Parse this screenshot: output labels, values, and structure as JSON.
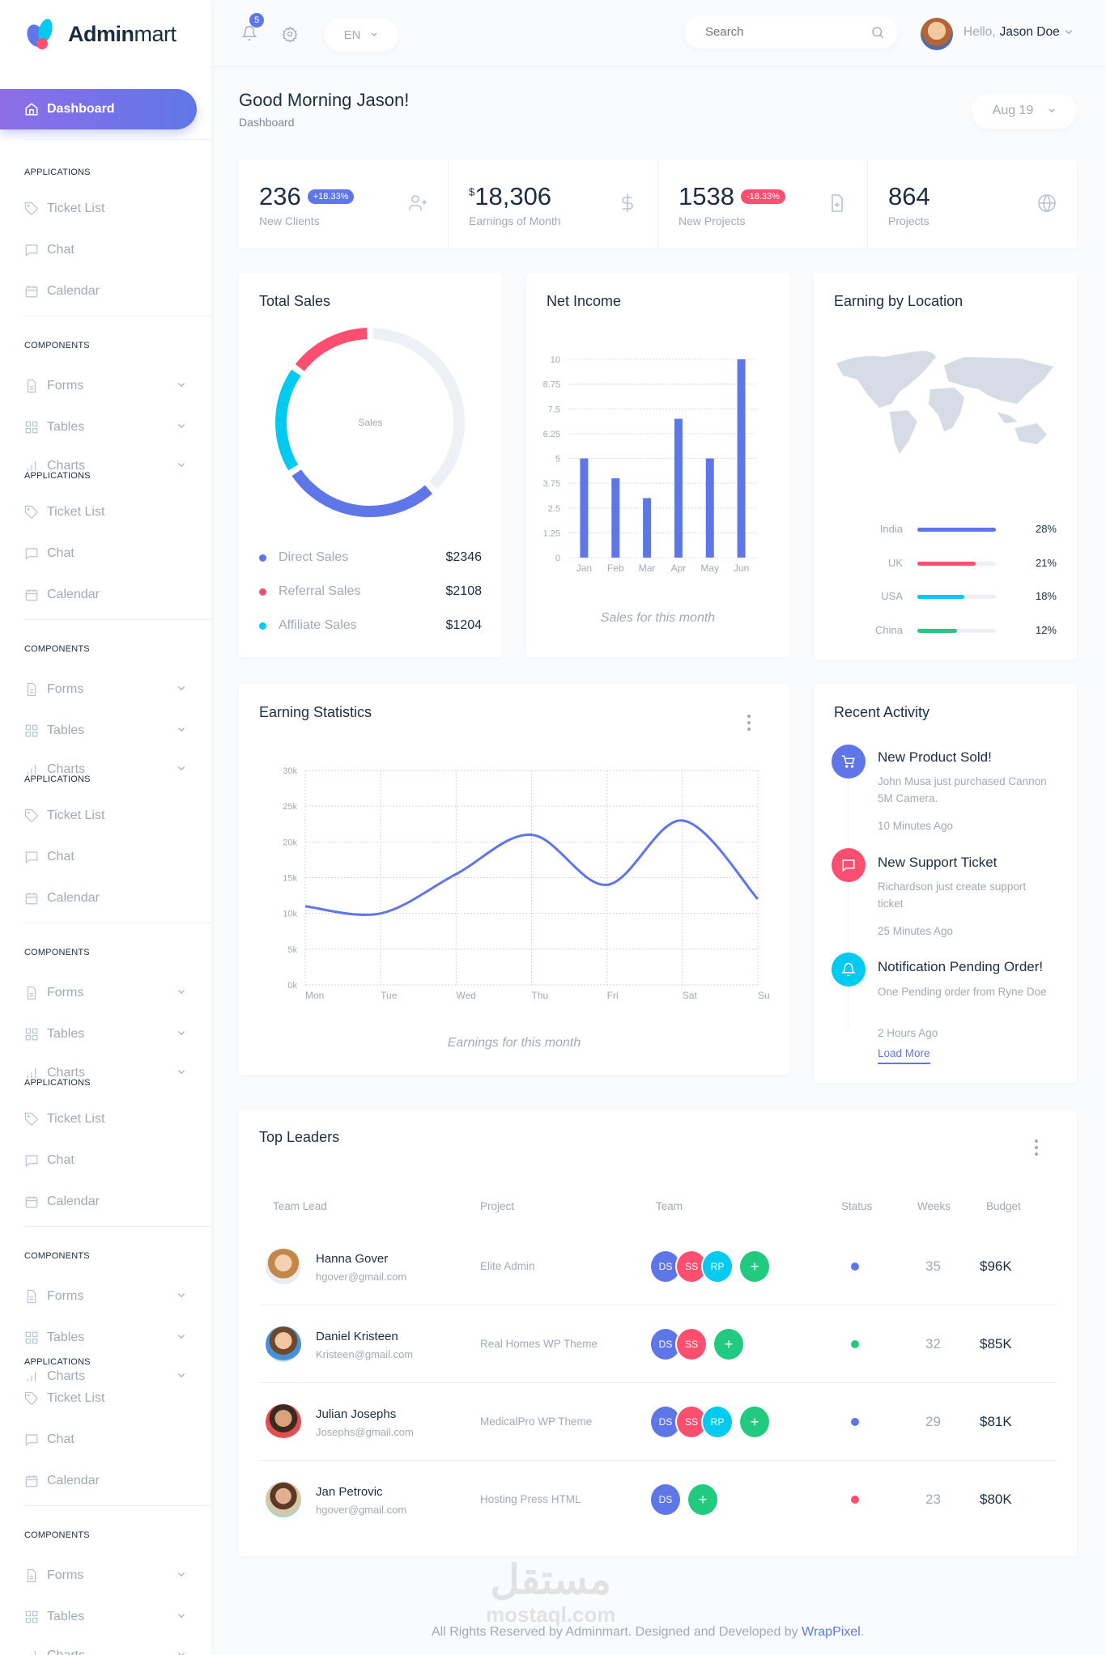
{
  "brand": {
    "name_bold": "Admin",
    "name_light": "mart"
  },
  "sidebar": {
    "active": {
      "label": "Dashboard",
      "icon": "home-icon"
    },
    "groups": [
      {
        "applications": "APPLICATIONS",
        "components": "COMPONENTS"
      }
    ],
    "items": {
      "ticket": "Ticket List",
      "chat": "Chat",
      "calendar": "Calendar",
      "forms": "Forms",
      "tables": "Tables",
      "charts": "Charts"
    }
  },
  "topbar": {
    "notifications_count": "5",
    "language": "EN",
    "search_placeholder": "Search",
    "greeting_prefix": "Hello,",
    "user_name": "Jason Doe"
  },
  "header": {
    "title": "Good Morning Jason!",
    "breadcrumb": "Dashboard",
    "date": "Aug 19"
  },
  "stats": [
    {
      "value": "236",
      "badge": "+18.33%",
      "badge_color": "#5f76e8",
      "label": "New Clients",
      "icon": "user-plus-icon"
    },
    {
      "currency": "$",
      "value": "18,306",
      "label": "Earnings of Month",
      "icon": "dollar-icon"
    },
    {
      "value": "1538",
      "badge": "-18.33%",
      "badge_color": "#ff4f70",
      "label": "New Projects",
      "icon": "file-plus-icon"
    },
    {
      "value": "864",
      "label": "Projects",
      "icon": "globe-icon"
    }
  ],
  "total_sales": {
    "title": "Total Sales",
    "center_label": "Sales",
    "legend": [
      {
        "name": "Direct Sales",
        "value": "$2346",
        "color": "#5f76e8"
      },
      {
        "name": "Referral Sales",
        "value": "$2108",
        "color": "#ff4f70"
      },
      {
        "name": "Affiliate Sales",
        "value": "$1204",
        "color": "#01caf1"
      }
    ]
  },
  "net_income": {
    "title": "Net Income",
    "caption": "Sales for this month"
  },
  "location": {
    "title": "Earning by Location",
    "rows": [
      {
        "country": "India",
        "percent": 28,
        "label": "28%",
        "color": "#5f76e8",
        "fill": 1.0
      },
      {
        "country": "UK",
        "percent": 21,
        "label": "21%",
        "color": "#ff4f70",
        "fill": 0.74
      },
      {
        "country": "USA",
        "percent": 18,
        "label": "18%",
        "color": "#01caf1",
        "fill": 0.6
      },
      {
        "country": "China",
        "percent": 12,
        "label": "12%",
        "color": "#22ca80",
        "fill": 0.5
      }
    ]
  },
  "earning_stats": {
    "title": "Earning Statistics",
    "caption": "Earnings for this month"
  },
  "activity": {
    "title": "Recent Activity",
    "load_more": "Load More",
    "items": [
      {
        "title": "New Product Sold!",
        "desc": "John Musa just purchased Cannon 5M Camera.",
        "time": "10 Minutes Ago",
        "icon": "cart-icon",
        "color": "#5f76e8"
      },
      {
        "title": "New Support Ticket",
        "desc": "Richardson just create support ticket",
        "time": "25 Minutes Ago",
        "icon": "message-icon",
        "color": "#ff4f70"
      },
      {
        "title": "Notification Pending Order!",
        "desc": "One Pending order from Ryne Doe",
        "time": "2 Hours Ago",
        "icon": "bell-icon",
        "color": "#01caf1"
      }
    ]
  },
  "leaders": {
    "title": "Top Leaders",
    "columns": [
      "Team Lead",
      "Project",
      "Team",
      "Status",
      "Weeks",
      "Budget"
    ],
    "rows": [
      {
        "name": "Hanna Gover",
        "email": "hgover@gmail.com",
        "project": "Elite Admin",
        "team": [
          "DS",
          "SS",
          "RP"
        ],
        "status_color": "#5f76e8",
        "weeks": "35",
        "budget": "$96K"
      },
      {
        "name": "Daniel Kristeen",
        "email": "Kristeen@gmail.com",
        "project": "Real Homes WP Theme",
        "team": [
          "DS",
          "SS"
        ],
        "status_color": "#22ca80",
        "weeks": "32",
        "budget": "$85K"
      },
      {
        "name": "Julian Josephs",
        "email": "Josephs@gmail.com",
        "project": "MedicalPro WP Theme",
        "team": [
          "DS",
          "SS",
          "RP"
        ],
        "status_color": "#5f76e8",
        "weeks": "29",
        "budget": "$81K"
      },
      {
        "name": "Jan Petrovic",
        "email": "hgover@gmail.com",
        "project": "Hosting Press HTML",
        "team": [
          "DS"
        ],
        "status_color": "#ff4f70",
        "weeks": "23",
        "budget": "$80K"
      }
    ],
    "add_label": "+"
  },
  "footer": {
    "text": "All Rights Reserved by Adminmart. Designed and Developed by ",
    "link": "WrapPixel",
    "end": "."
  },
  "watermark": {
    "arabic": "مستقل",
    "latin": "mostaql.com"
  },
  "colors": {
    "accent": "#5f76e8",
    "danger": "#ff4f70",
    "info": "#01caf1",
    "success": "#22ca80"
  },
  "chart_data": [
    {
      "type": "pie",
      "variant": "donut",
      "center_label": "Sales",
      "series": [
        {
          "name": "Direct Sales",
          "value": 28
        },
        {
          "name": "Affiliate Sales",
          "value": 19
        },
        {
          "name": "Referral Sales",
          "value": 15
        }
      ],
      "remainder": 38
    },
    {
      "type": "bar",
      "categories": [
        "Jan",
        "Feb",
        "Mar",
        "Apr",
        "May",
        "Jun"
      ],
      "values": [
        5,
        4,
        3,
        7,
        5,
        10
      ],
      "ylim": [
        0,
        10
      ],
      "yticks": [
        "0",
        "1.25",
        "2.5",
        "3.75",
        "5",
        "6.25",
        "7.5",
        "8.75",
        "10"
      ],
      "grid": true,
      "xlabel": "Sales for this month"
    },
    {
      "type": "line",
      "categories": [
        "Mon",
        "Tue",
        "Wed",
        "Thu",
        "Fri",
        "Sat",
        "Su"
      ],
      "values": [
        11000,
        10000,
        15500,
        21000,
        14000,
        23000,
        12000
      ],
      "ylim": [
        0,
        30000
      ],
      "yticks": [
        "0k",
        "5k",
        "10k",
        "15k",
        "20k",
        "25k",
        "30k"
      ],
      "grid": true,
      "xlabel": "Earnings for this month"
    }
  ]
}
